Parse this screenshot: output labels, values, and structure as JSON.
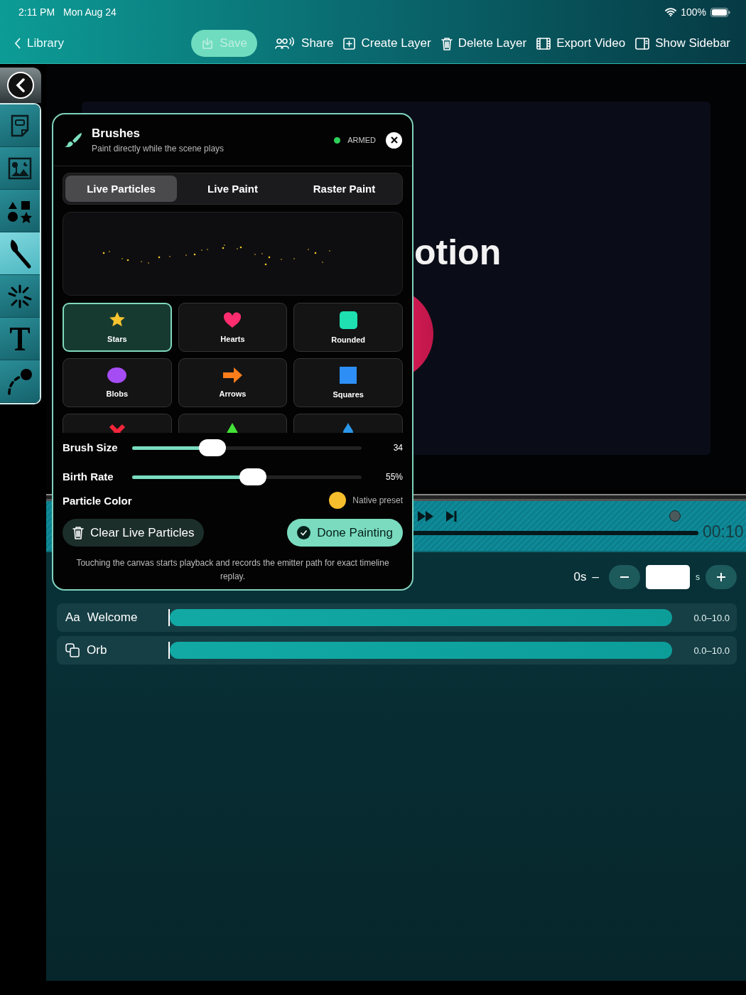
{
  "status_bar": {
    "time": "2:11 PM",
    "date": "Mon Aug 24",
    "battery": "100%"
  },
  "toolbar": {
    "back": "Library",
    "actions": [
      {
        "kind": "save",
        "label": "Save",
        "disabled": true
      },
      {
        "kind": "share",
        "label": "Share",
        "disabled": false
      },
      {
        "kind": "create",
        "label": "Create Layer",
        "disabled": false
      },
      {
        "kind": "delete",
        "label": "Delete Layer",
        "disabled": false
      },
      {
        "kind": "export",
        "label": "Export Video",
        "disabled": false
      },
      {
        "kind": "sidebar",
        "label": "Show Sidebar",
        "disabled": false
      }
    ]
  },
  "tool_strip": [
    {
      "kind": "note",
      "selected": false
    },
    {
      "kind": "image",
      "selected": false
    },
    {
      "kind": "shapes",
      "selected": false
    },
    {
      "kind": "brush",
      "selected": true
    },
    {
      "kind": "sparkle",
      "selected": false
    },
    {
      "kind": "text",
      "selected": false
    },
    {
      "kind": "path",
      "selected": false
    }
  ],
  "canvas": {
    "title": "otion"
  },
  "brush_panel": {
    "title": "Brushes",
    "subtitle": "Paint directly while the scene plays",
    "status": "ARMED",
    "tabs": [
      {
        "label": "Live Particles",
        "selected": true
      },
      {
        "label": "Live Paint",
        "selected": false
      },
      {
        "label": "Raster Paint",
        "selected": false
      }
    ],
    "brushes": [
      {
        "kind": "star",
        "label": "Stars",
        "selected": true
      },
      {
        "kind": "heart",
        "label": "Hearts",
        "selected": false
      },
      {
        "kind": "rounded",
        "label": "Rounded",
        "selected": false
      },
      {
        "kind": "blob",
        "label": "Blobs",
        "selected": false
      },
      {
        "kind": "arrow",
        "label": "Arrows",
        "selected": false
      },
      {
        "kind": "square",
        "label": "Squares",
        "selected": false
      },
      {
        "kind": "cross",
        "selected": false
      },
      {
        "kind": "triangle",
        "selected": false
      },
      {
        "kind": "drop",
        "selected": false
      }
    ],
    "sliders": [
      {
        "label": "Brush Size",
        "level": 0.33,
        "reading": "34"
      },
      {
        "label": "Birth Rate",
        "level": 0.53,
        "reading": "55%"
      }
    ],
    "particle_color": {
      "label": "Particle Color",
      "color": "#f6bd2c",
      "value": "Native preset"
    },
    "buttons": [
      {
        "kind": "clear",
        "label": "Clear Live Particles"
      },
      {
        "kind": "done",
        "label": "Done Painting"
      }
    ],
    "note": "Touching the canvas starts playback and records the emitter path for exact timeline replay."
  },
  "timeline": {
    "time": "00:10"
  },
  "duration": {
    "start": "0s",
    "separator": "–",
    "unit": "s"
  },
  "layers": [
    {
      "kind": "text",
      "icon_text": "Aa",
      "name": "Welcome",
      "range": "0.0–10.0"
    },
    {
      "kind": "shape",
      "name": "Orb",
      "range": "0.0–10.0"
    }
  ]
}
